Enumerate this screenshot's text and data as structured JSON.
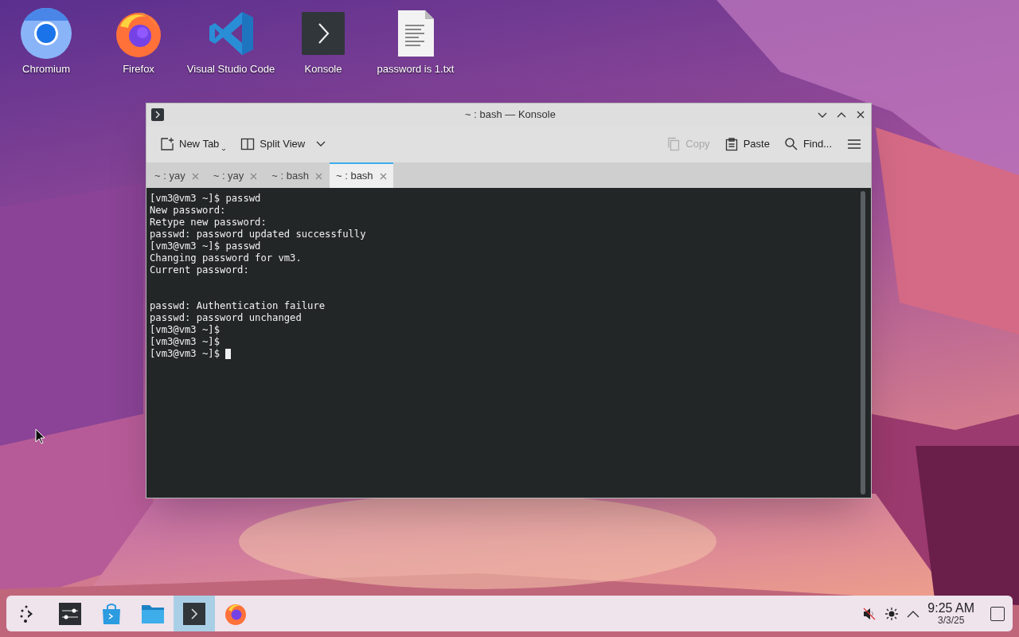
{
  "desktop_icons": [
    {
      "kind": "chromium",
      "label": "Chromium"
    },
    {
      "kind": "firefox",
      "label": "Firefox"
    },
    {
      "kind": "vscode",
      "label": "Visual Studio Code"
    },
    {
      "kind": "konsole",
      "label": "Konsole"
    },
    {
      "kind": "textfile",
      "label": "password is 1.txt"
    }
  ],
  "window": {
    "title": "~ : bash — Konsole",
    "toolbar_left": [
      {
        "kind": "new-tab",
        "label": "New Tab",
        "disabled": false
      },
      {
        "kind": "split-view",
        "label": "Split View",
        "disabled": false
      }
    ],
    "toolbar_right": [
      {
        "kind": "copy",
        "label": "Copy",
        "disabled": true
      },
      {
        "kind": "paste",
        "label": "Paste",
        "disabled": false
      },
      {
        "kind": "find",
        "label": "Find...",
        "disabled": false
      }
    ],
    "tabs": [
      {
        "label": "~ : yay",
        "selected": false
      },
      {
        "label": "~ : yay",
        "selected": false
      },
      {
        "label": "~ : bash",
        "selected": false
      },
      {
        "label": "~ : bash",
        "selected": true
      }
    ],
    "terminal_lines": [
      {
        "kind": "text",
        "text": "[vm3@vm3 ~]$ passwd"
      },
      {
        "kind": "text",
        "text": "New password:"
      },
      {
        "kind": "text",
        "text": "Retype new password:"
      },
      {
        "kind": "text",
        "text": "passwd: password updated successfully"
      },
      {
        "kind": "text",
        "text": "[vm3@vm3 ~]$ passwd"
      },
      {
        "kind": "text",
        "text": "Changing password for vm3."
      },
      {
        "kind": "text",
        "text": "Current password:"
      },
      {
        "kind": "blank"
      },
      {
        "kind": "blank"
      },
      {
        "kind": "text",
        "text": "passwd: Authentication failure"
      },
      {
        "kind": "text",
        "text": "passwd: password unchanged"
      },
      {
        "kind": "text",
        "text": "[vm3@vm3 ~]$"
      },
      {
        "kind": "text",
        "text": "[vm3@vm3 ~]$"
      },
      {
        "kind": "text",
        "text": "[vm3@vm3 ~]$",
        "cursor": true
      }
    ]
  },
  "taskbar": {
    "items": [
      {
        "kind": "launcher",
        "selected": false
      },
      {
        "kind": "settings",
        "selected": false
      },
      {
        "kind": "discover",
        "selected": false
      },
      {
        "kind": "folder",
        "selected": false
      },
      {
        "kind": "konsole",
        "selected": true
      },
      {
        "kind": "firefox",
        "selected": false
      }
    ],
    "tray": [
      {
        "kind": "muted"
      },
      {
        "kind": "brightness"
      },
      {
        "kind": "expand"
      }
    ],
    "time": "9:25 AM",
    "date": "3/3/25"
  }
}
